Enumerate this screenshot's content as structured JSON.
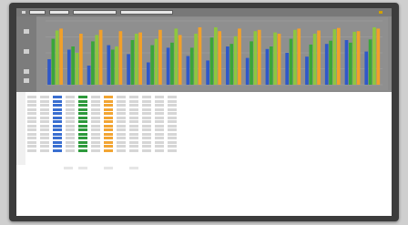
{
  "colors": {
    "blue": "#2f58c8",
    "green": "#3aa63a",
    "lime": "#8ec63f",
    "orange": "#f2a029",
    "chart_bg": "#8f8f8f"
  },
  "icons": {
    "close": "close-icon",
    "app": "app-icon"
  },
  "chart_data": {
    "type": "bar",
    "categories": [
      "",
      "",
      "",
      "",
      "",
      "",
      "",
      "",
      "",
      "",
      "",
      "",
      "",
      "",
      "",
      "",
      ""
    ],
    "series": [
      {
        "values": [
          40,
          55,
          30,
          62,
          48,
          35,
          58,
          45,
          38,
          60,
          42,
          56,
          50,
          44,
          64,
          70,
          52
        ]
      },
      {
        "values": [
          72,
          60,
          68,
          55,
          70,
          62,
          66,
          58,
          74,
          64,
          68,
          60,
          72,
          63,
          69,
          66,
          71
        ]
      },
      {
        "values": [
          85,
          50,
          78,
          60,
          80,
          72,
          88,
          80,
          90,
          76,
          84,
          82,
          86,
          80,
          87,
          83,
          90
        ]
      },
      {
        "values": [
          88,
          80,
          86,
          84,
          82,
          86,
          78,
          90,
          84,
          88,
          86,
          80,
          88,
          85,
          89,
          84,
          88
        ]
      }
    ],
    "ylim": [
      0,
      100
    ],
    "grid": true
  }
}
